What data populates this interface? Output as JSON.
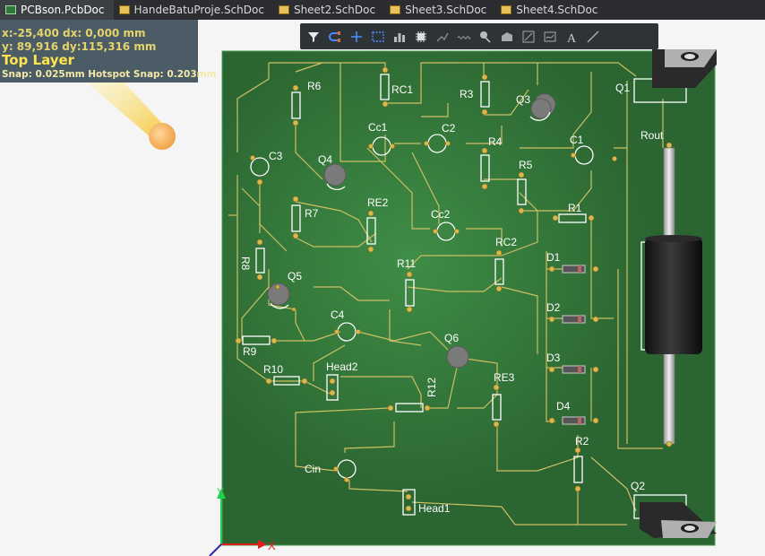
{
  "tabs": [
    {
      "label": "PCBson.PcbDoc",
      "icon": "pcb-doc-icon",
      "active": true
    },
    {
      "label": "HandeBatuProje.SchDoc",
      "icon": "sch-doc-icon",
      "active": false
    },
    {
      "label": "Sheet2.SchDoc",
      "icon": "sch-doc-icon",
      "active": false
    },
    {
      "label": "Sheet3.SchDoc",
      "icon": "sch-doc-icon",
      "active": false
    },
    {
      "label": "Sheet4.SchDoc",
      "icon": "sch-doc-icon",
      "active": false
    }
  ],
  "info": {
    "x_line": "x:-25,400   dx:  0,000   mm",
    "y_line": "y: 89,916   dy:115,316  mm",
    "layer": "Top Layer",
    "snap": "Snap: 0.025mm Hotspot Snap: 0.203mm"
  },
  "toolbar": [
    "filter-icon",
    "interactive-route-icon",
    "add-cross-icon",
    "select-rect-icon",
    "chart-icon",
    "component-icon",
    "route-icon",
    "diff-pair-icon",
    "place-pin-icon",
    "polygon-icon",
    "dimension-icon",
    "region-icon",
    "text-icon",
    "line-icon"
  ],
  "components": {
    "R6": "R6",
    "RC1": "RC1",
    "R3": "R3",
    "Q3": "Q3",
    "Q1": "Q1",
    "C3": "C3",
    "Q4": "Q4",
    "Cc1": "Cc1",
    "C2": "C2",
    "R4": "R4",
    "C1": "C1",
    "Rout": "Rout",
    "R5": "R5",
    "R7": "R7",
    "RE2": "RE2",
    "Cc2": "Cc2",
    "R1": "R1",
    "R8": "R8",
    "RC2": "RC2",
    "Q5": "Q5",
    "R11": "R11",
    "D1": "D1",
    "D2": "D2",
    "C4": "C4",
    "Q6": "Q6",
    "D3": "D3",
    "R9": "R9",
    "R10": "R10",
    "Head2": "Head2",
    "R12": "R12",
    "RE3": "RE3",
    "D4": "D4",
    "R2": "R2",
    "Cin": "Cin",
    "Q2": "Q2",
    "Head1": "Head1"
  },
  "axes": {
    "y": "Y",
    "x": "X"
  },
  "colors": {
    "board": "#2e6b34",
    "board_edge": "#3d8a45",
    "track": "#cfc66a",
    "pad": "#d4b552",
    "silk": "#ffffff"
  }
}
